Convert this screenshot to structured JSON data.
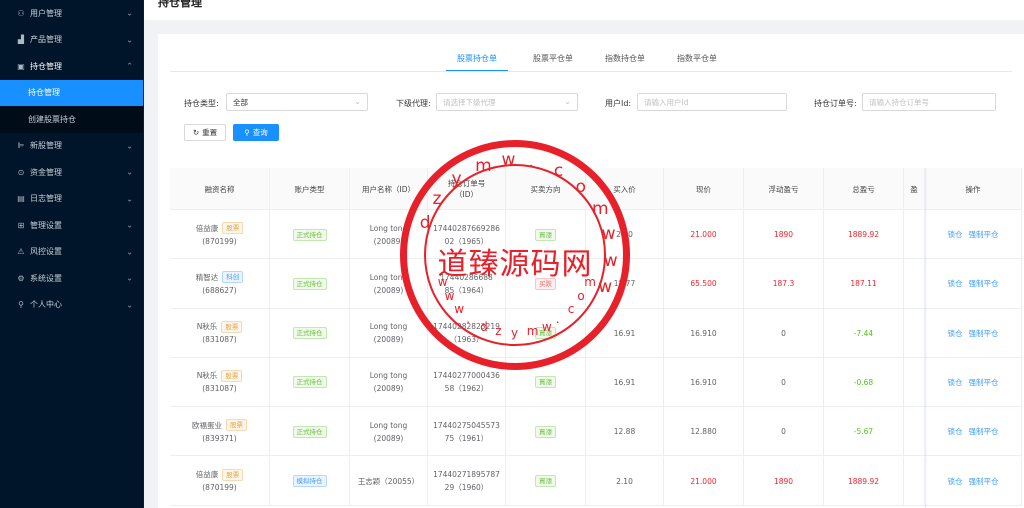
{
  "sidebar": {
    "items": [
      {
        "icon": "user-group-icon",
        "glyph": "⚇",
        "label": "用户管理",
        "chevron": "⌄"
      },
      {
        "icon": "chart-icon",
        "glyph": "▟",
        "label": "产品管理",
        "chevron": "⌄"
      },
      {
        "icon": "position-icon",
        "glyph": "▣",
        "label": "持仓管理",
        "chevron": "⌃",
        "open": true,
        "children": [
          {
            "label": "持仓管理",
            "active": true
          },
          {
            "label": "创建股票持仓",
            "active": false
          }
        ]
      },
      {
        "icon": "ipo-icon",
        "glyph": "⊫",
        "label": "新股管理",
        "chevron": "⌄"
      },
      {
        "icon": "money-icon",
        "glyph": "⊙",
        "label": "资金管理",
        "chevron": "⌄"
      },
      {
        "icon": "log-icon",
        "glyph": "▤",
        "label": "日志管理",
        "chevron": "⌄"
      },
      {
        "icon": "settings-grid-icon",
        "glyph": "⊞",
        "label": "管理设置",
        "chevron": "⌄"
      },
      {
        "icon": "warning-icon",
        "glyph": "⚠",
        "label": "风控设置",
        "chevron": "⌄"
      },
      {
        "icon": "gear-icon",
        "glyph": "⚙",
        "label": "系统设置",
        "chevron": "⌄"
      },
      {
        "icon": "person-icon",
        "glyph": "⚲",
        "label": "个人中心",
        "chevron": "⌄"
      }
    ]
  },
  "page": {
    "title": "持仓管理"
  },
  "tabs": [
    "股票持仓单",
    "股票平仓单",
    "指数持仓单",
    "指数平仓单"
  ],
  "filters": {
    "type_label": "持仓类型:",
    "type_value": "全部",
    "agent_label": "下级代理:",
    "agent_placeholder": "请选择下级代理",
    "userid_label": "用户Id:",
    "userid_placeholder": "请输入用户Id",
    "order_label": "持仓订单号:",
    "order_placeholder": "请输入持仓订单号",
    "reset_label": "重置",
    "search_label": "查询"
  },
  "table": {
    "headers": [
      "融资名称",
      "账户类型",
      "用户名称（ID）",
      "持仓订单号\n（ID）",
      "买卖方向",
      "买入价",
      "现价",
      "浮动盈亏",
      "总盈亏",
      "盈",
      "操作"
    ],
    "rows": [
      {
        "name": "倍益康",
        "code": "(870199)",
        "kind": "股票",
        "kind_color": "orange",
        "account": "正式持仓",
        "account_color": "green",
        "user": "Long tong\n(20089)",
        "order": "17440287669286\n02（1965）",
        "dir": "買漲",
        "dir_color": "green",
        "buy": "2.10",
        "now": "21.000",
        "now_color": "red",
        "float": "1890",
        "float_color": "red",
        "total": "1889.92",
        "total_color": "red"
      },
      {
        "name": "精智达",
        "code": "(688627)",
        "kind": "科创",
        "kind_color": "blue",
        "account": "正式持仓",
        "account_color": "green",
        "user": "Long tong\n(20089)",
        "order": "17440286688\n85（1964）",
        "dir": "买跌",
        "dir_color": "red",
        "buy": "18.77",
        "now": "65.500",
        "now_color": "red",
        "float": "187.3",
        "float_color": "red",
        "total": "187.11",
        "total_color": "red"
      },
      {
        "name": "N秋乐",
        "code": "(831087)",
        "kind": "股票",
        "kind_color": "orange",
        "account": "正式持仓",
        "account_color": "green",
        "user": "Long tong\n(20089)",
        "order": "17440282823219\n（1963）",
        "dir": "買漲",
        "dir_color": "green",
        "buy": "16.91",
        "now": "16.910",
        "now_color": "",
        "float": "0",
        "float_color": "",
        "total": "-7.44",
        "total_color": "green"
      },
      {
        "name": "N秋乐",
        "code": "(831087)",
        "kind": "股票",
        "kind_color": "orange",
        "account": "正式持仓",
        "account_color": "green",
        "user": "Long tong\n(20089)",
        "order": "17440277000436\n58（1962）",
        "dir": "買漲",
        "dir_color": "green",
        "buy": "16.91",
        "now": "16.910",
        "now_color": "",
        "float": "0",
        "float_color": "",
        "total": "-0.68",
        "total_color": "green"
      },
      {
        "name": "欧福蛋业",
        "code": "(839371)",
        "kind": "股票",
        "kind_color": "orange",
        "account": "正式持仓",
        "account_color": "green",
        "user": "Long tong\n(20089)",
        "order": "17440275045573\n75（1961）",
        "dir": "買漲",
        "dir_color": "green",
        "buy": "12.88",
        "now": "12.880",
        "now_color": "",
        "float": "0",
        "float_color": "",
        "total": "-5.67",
        "total_color": "green"
      },
      {
        "name": "倍益康",
        "code": "(870199)",
        "kind": "股票",
        "kind_color": "orange",
        "account": "模拟持仓",
        "account_color": "blue",
        "user": "王志颖（20055）",
        "order": "17440271895787\n29（1960）",
        "dir": "買漲",
        "dir_color": "green",
        "buy": "2.10",
        "now": "21.000",
        "now_color": "red",
        "float": "1890",
        "float_color": "red",
        "total": "1889.92",
        "total_color": "red"
      }
    ],
    "ops": [
      "锁仓",
      "强制平仓"
    ]
  },
  "watermark": {
    "center": "道臻源码网",
    "ring": [
      "d",
      "z",
      "y",
      "m",
      "w",
      ".",
      "c",
      "o",
      "m",
      "w",
      "w",
      "w"
    ],
    "inner": [
      "w",
      "w",
      "w",
      ".",
      "d",
      "z",
      "y",
      "m",
      "w",
      ".",
      "c",
      "o",
      "m"
    ]
  },
  "colors": {
    "sidebar_bg": "#001529",
    "accent": "#1890ff",
    "profit_red": "#f5222d",
    "loss_green": "#52c41a",
    "stamp_red": "#e8202a"
  }
}
